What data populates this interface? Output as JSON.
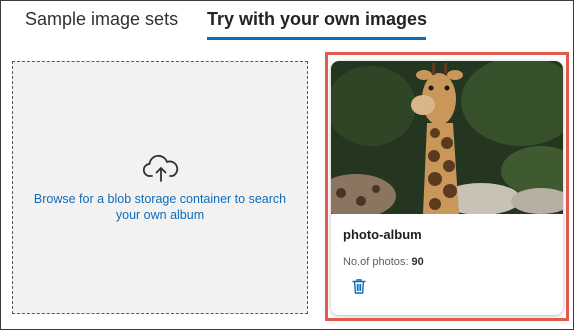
{
  "tabs": {
    "sample_label": "Sample image sets",
    "own_label": "Try with your own images",
    "active": "own"
  },
  "browse": {
    "icon": "cloud-upload-icon",
    "text": "Browse for a blob storage container to search your own album"
  },
  "album_card": {
    "title": "photo-album",
    "count_label": "No.of photos:",
    "count_value": "90",
    "image_subject": "giraffe",
    "delete_icon": "trash-icon"
  },
  "colors": {
    "accent": "#0f6cbd",
    "highlight": "#e05a4f",
    "browse_background": "#f3f2f1"
  }
}
